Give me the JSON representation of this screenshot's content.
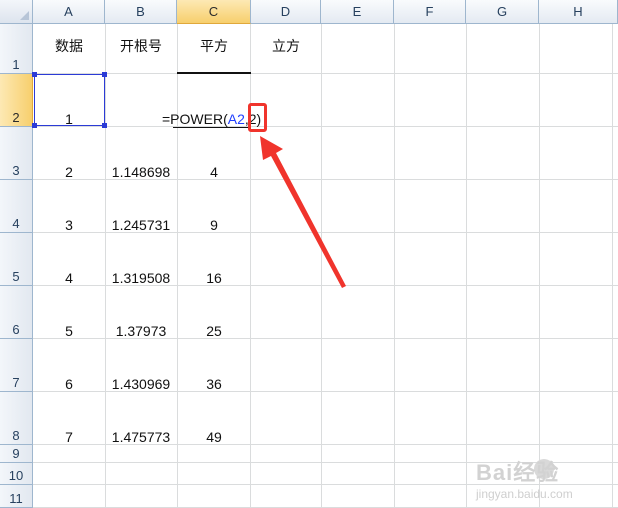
{
  "columns": [
    "A",
    "B",
    "C",
    "D",
    "E",
    "F",
    "G",
    "H"
  ],
  "rows": [
    "1",
    "2",
    "3",
    "4",
    "5",
    "6",
    "7",
    "8",
    "9",
    "10",
    "11"
  ],
  "headers_row": {
    "a": "数据",
    "b": "开根号",
    "c": "平方",
    "d": "立方"
  },
  "data_rows": [
    {
      "a": "1",
      "b": "",
      "c": ""
    },
    {
      "a": "2",
      "b": "1.148698",
      "c": "4"
    },
    {
      "a": "3",
      "b": "1.245731",
      "c": "9"
    },
    {
      "a": "4",
      "b": "1.319508",
      "c": "16"
    },
    {
      "a": "5",
      "b": "1.37973",
      "c": "25"
    },
    {
      "a": "6",
      "b": "1.430969",
      "c": "36"
    },
    {
      "a": "7",
      "b": "1.475773",
      "c": "49"
    }
  ],
  "formula": {
    "prefix": "=POWER(",
    "ref": "A2",
    "suffix": ",2)"
  },
  "active_column": "C",
  "active_row": "2",
  "colors": {
    "selection": "#2b3bd6",
    "annotation": "#f0342c",
    "cell_ref": "#1f3fff"
  },
  "watermark": {
    "brand": "Bai经验",
    "url": "jingyan.baidu.com"
  }
}
